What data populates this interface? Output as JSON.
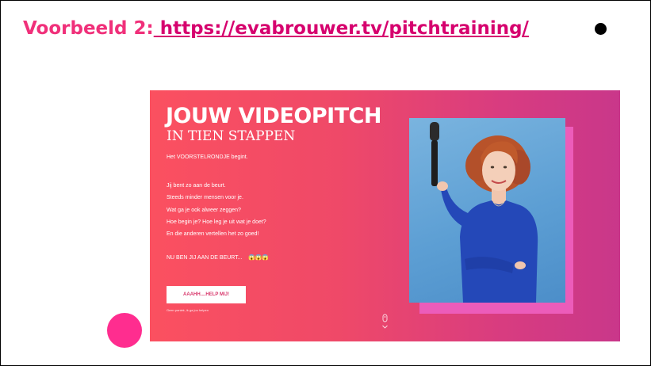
{
  "slide": {
    "title_prefix": "Voorbeeld 2:",
    "title_link": " https://evabrouwer.tv/pitchtraining/",
    "bullet_icon": "black-dot",
    "accent_circle_color": "#ff2d8f"
  },
  "webpage": {
    "heading": "JOUW VIDEOPITCH",
    "subheading": "IN TIEN STAPPEN",
    "intro": "Het VOORSTELRONDJE begint.",
    "lines": [
      "Jij bent zo aan de beurt.",
      "Steeds minder mensen voor je.",
      "Wat ga je ook alweer zeggen?",
      "Hoe begin je? Hoe leg je uit wat je doet?",
      "En die anderen vertellen het zo goed!"
    ],
    "cta_text": "NU BEN JIJ AAN DE BEURT...",
    "cta_emojis": "😱😱😱",
    "button_label": "AAAHH....HELP MIJ!",
    "help_text": "Geen paniek, ik ga jou helpen",
    "photo": "woman-holding-microphone",
    "scroll_icon": "scroll-down-icon",
    "colors": {
      "gradient_start": "#fb5060",
      "gradient_end": "#c9378a",
      "photo_frame": "#ec5cba",
      "title": "#f0307a"
    }
  }
}
